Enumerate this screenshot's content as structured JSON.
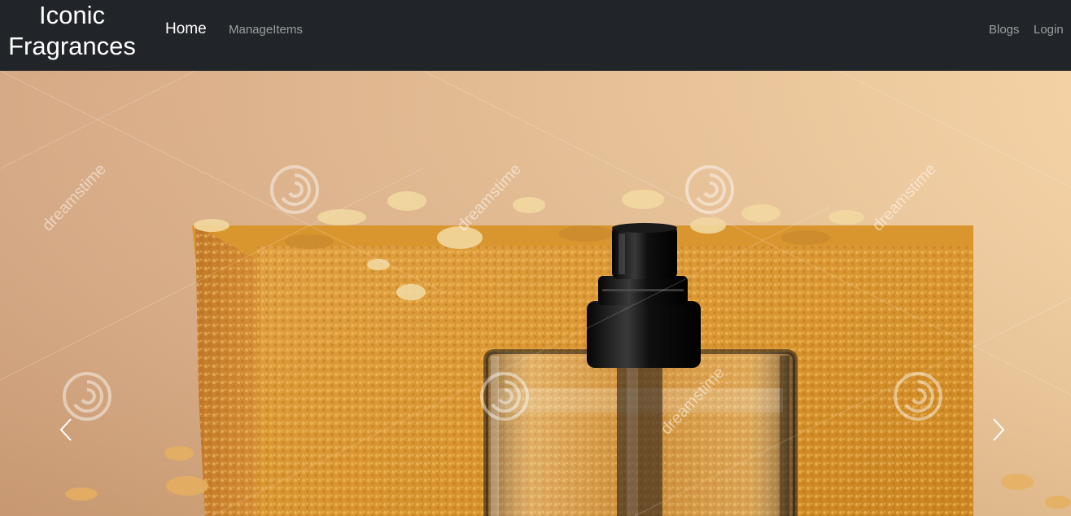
{
  "navbar": {
    "brand_line1": "Iconic",
    "brand_line2": "Fragrances",
    "links": {
      "home": "Home",
      "manage_items": "ManageItems",
      "blogs": "Blogs",
      "login": "Login"
    },
    "background_color": "#212529"
  },
  "carousel": {
    "slide_description": "perfume-bottle-photo",
    "watermark_text": "dreamstime",
    "prev_icon": "chevron-left-icon",
    "next_icon": "chevron-right-icon"
  }
}
